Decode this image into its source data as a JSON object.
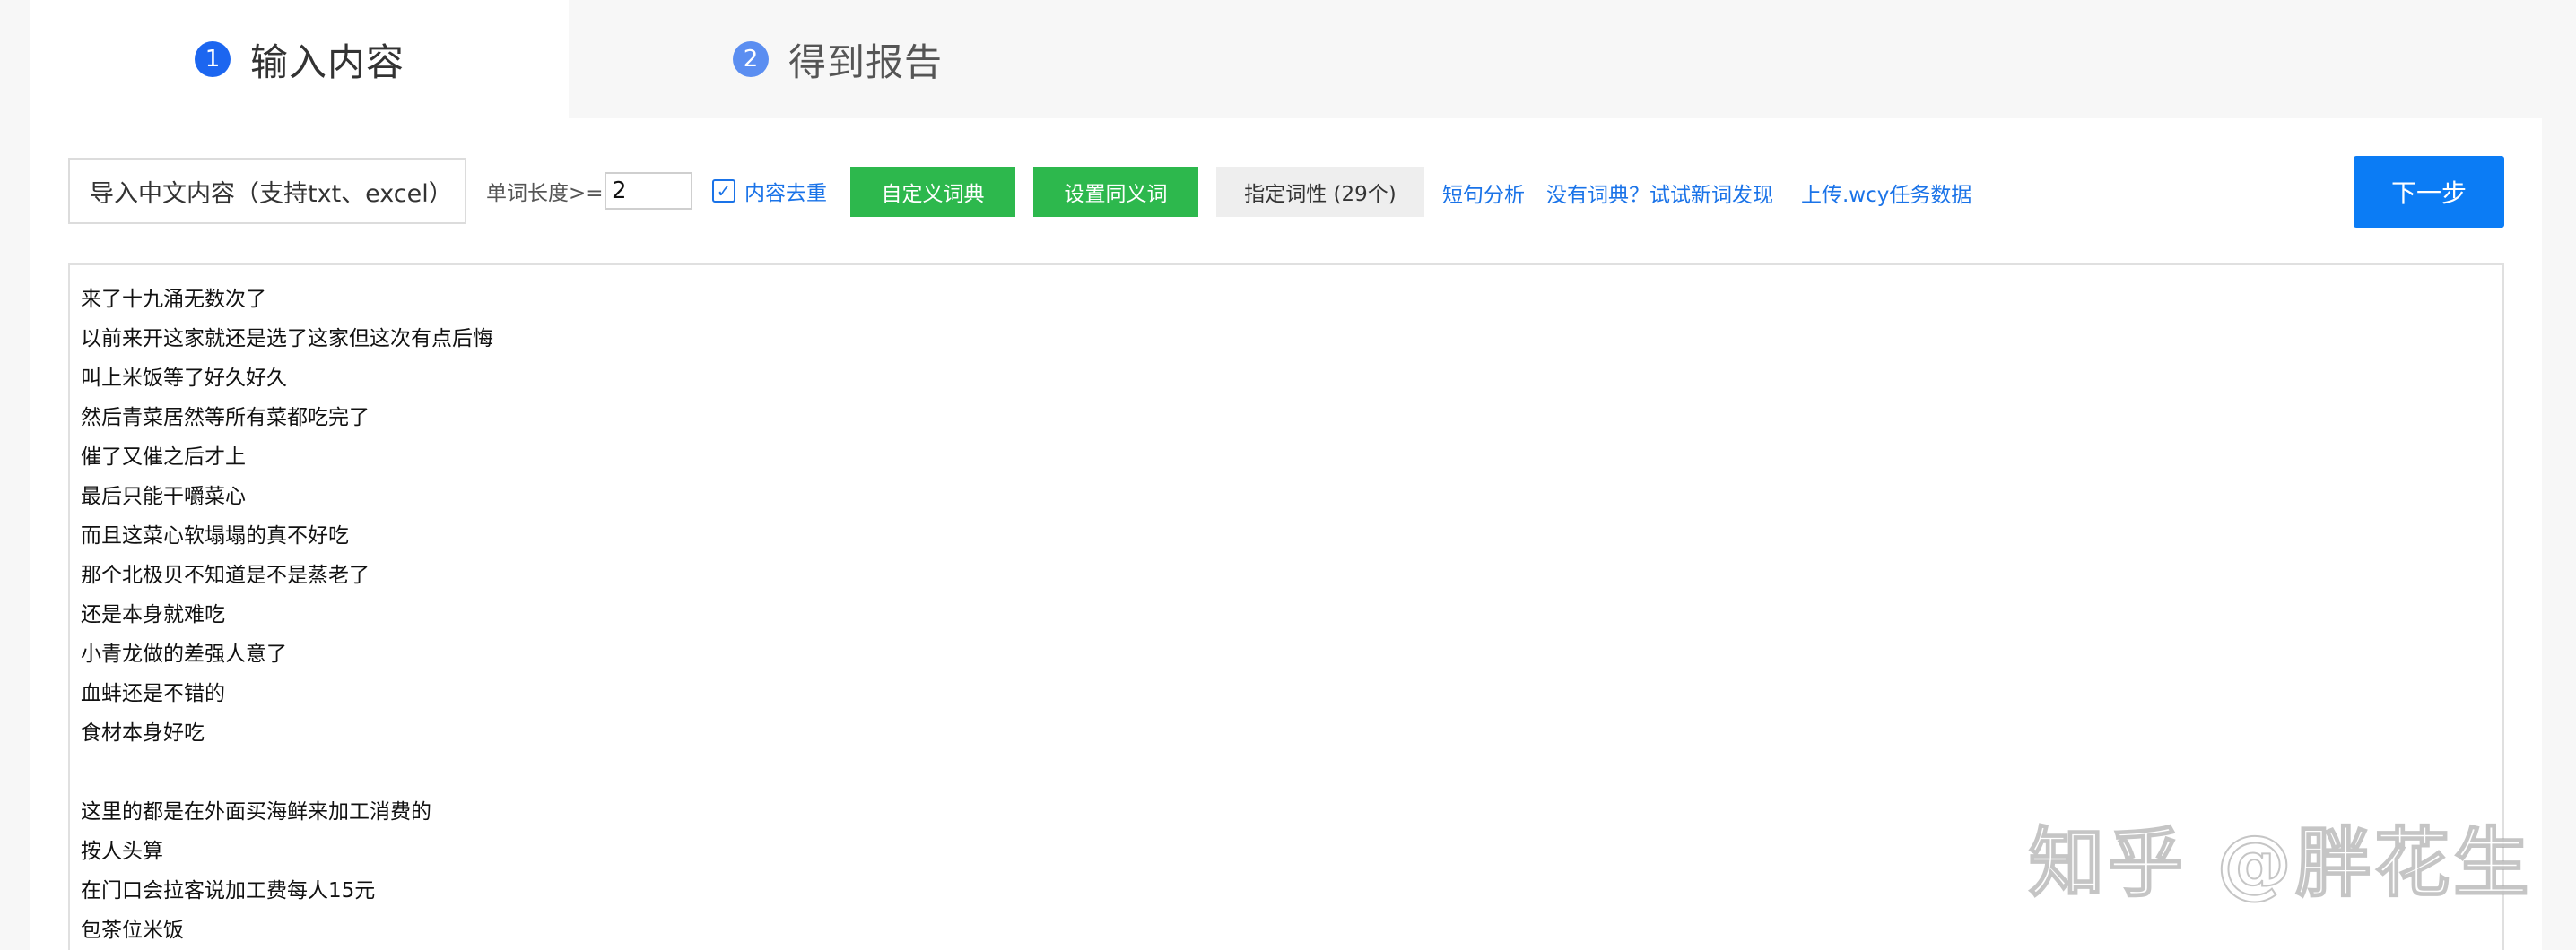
{
  "tabs": [
    {
      "num": "1",
      "label": "输入内容",
      "active": true
    },
    {
      "num": "2",
      "label": "得到报告",
      "active": false
    }
  ],
  "toolbar": {
    "import_label": "导入中文内容（支持txt、excel）",
    "word_length_label": "单词长度>=",
    "word_length_value": "2",
    "dedupe_label": "内容去重",
    "dedupe_checked": true,
    "custom_dict_label": "自定义词典",
    "synonym_label": "设置同义词",
    "pos_label": "指定词性 (29个)",
    "short_sentence_link": "短句分析",
    "new_word_link": "没有词典？试试新词发现",
    "upload_link": "上传.wcy任务数据",
    "next_label": "下一步"
  },
  "content_lines": [
    "来了十九涌无数次了",
    "以前来开这家就还是选了这家但这次有点后悔",
    "叫上米饭等了好久好久",
    "然后青菜居然等所有菜都吃完了",
    "催了又催之后才上",
    "最后只能干嚼菜心",
    "而且这菜心软塌塌的真不好吃",
    "那个北极贝不知道是不是蒸老了",
    "还是本身就难吃",
    "小青龙做的差强人意了",
    "血蚌还是不错的",
    "食材本身好吃",
    "",
    "这里的都是在外面买海鲜来加工消费的",
    "按人头算",
    "在门口会拉客说加工费每人15元",
    "包茶位米饭"
  ],
  "watermark": "知乎 @胖花生",
  "colors": {
    "primary_blue": "#1a73e8",
    "next_button": "#0b7cf5",
    "green_button": "#2db84d",
    "tab_active_num": "#1c66f0",
    "tab_inactive_num": "#5b8ef1"
  }
}
